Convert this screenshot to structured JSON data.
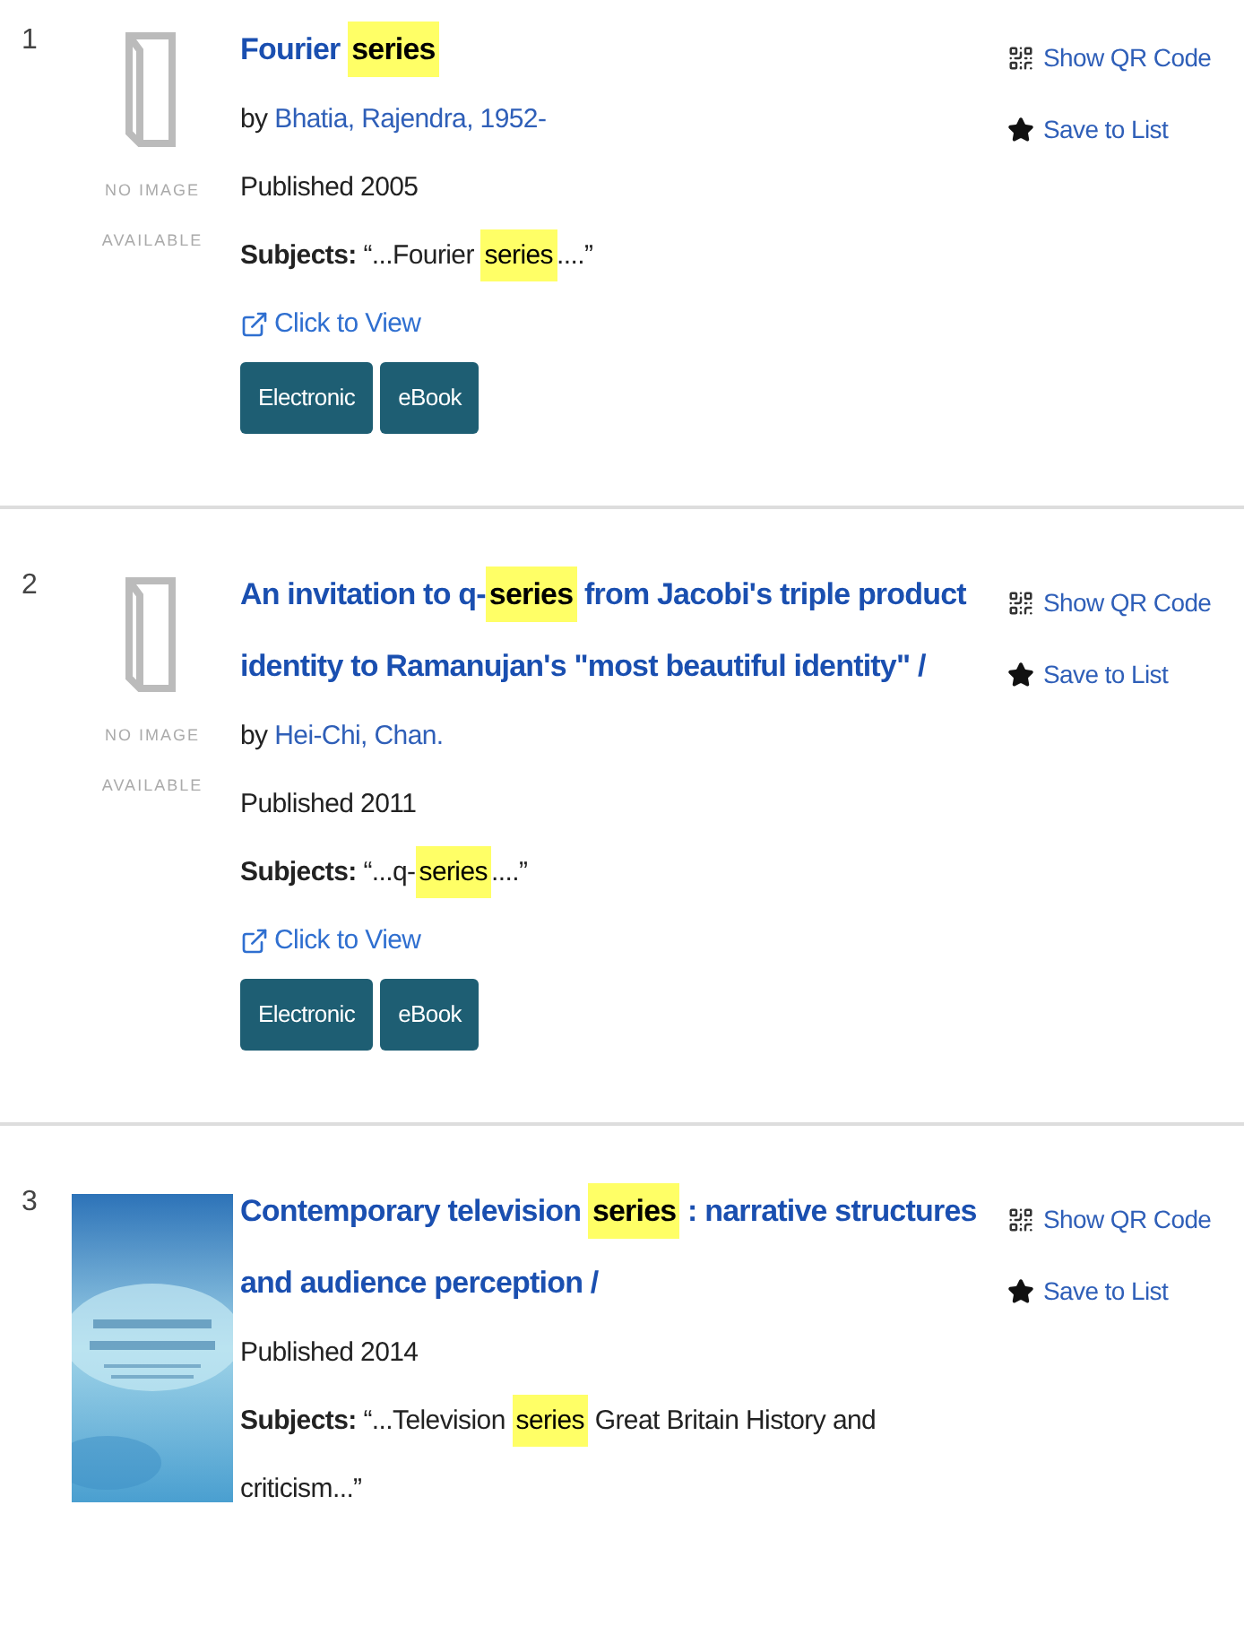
{
  "results": [
    {
      "number": "1",
      "cover": {
        "kind": "placeholder",
        "lines": [
          "NO IMAGE",
          "AVAILABLE"
        ]
      },
      "title": [
        {
          "text": "Fourier ",
          "highlight": false
        },
        {
          "text": "series",
          "highlight": true
        }
      ],
      "author_prefix": "by",
      "author": "Bhatia, Rajendra, 1952-",
      "published": "Published 2005",
      "subjects_label": "Subjects:",
      "subjects": [
        {
          "text": "“...Fourier ",
          "highlight": false
        },
        {
          "text": "series",
          "highlight": true
        },
        {
          "text": "....”",
          "highlight": false
        }
      ],
      "link": "Click to View",
      "formats": [
        "Electronic",
        "eBook"
      ],
      "actions": [
        {
          "kind": "qr",
          "label": "Show QR Code"
        },
        {
          "kind": "save",
          "label": "Save to List"
        }
      ]
    },
    {
      "number": "2",
      "cover": {
        "kind": "placeholder",
        "lines": [
          "NO IMAGE",
          "AVAILABLE"
        ]
      },
      "title": [
        {
          "text": "An invitation to q-",
          "highlight": false
        },
        {
          "text": "series",
          "highlight": true
        },
        {
          "text": " from Jacobi's triple product identity to Ramanujan's \"most beautiful identity\" /",
          "highlight": false
        }
      ],
      "author_prefix": "by",
      "author": "Hei-Chi, Chan.",
      "published": "Published 2011",
      "subjects_label": "Subjects:",
      "subjects": [
        {
          "text": "“...q-",
          "highlight": false
        },
        {
          "text": "series",
          "highlight": true
        },
        {
          "text": "....”",
          "highlight": false
        }
      ],
      "link": "Click to View",
      "formats": [
        "Electronic",
        "eBook"
      ],
      "actions": [
        {
          "kind": "qr",
          "label": "Show QR Code"
        },
        {
          "kind": "save",
          "label": "Save to List"
        }
      ]
    },
    {
      "number": "3",
      "cover": {
        "kind": "picture"
      },
      "title": [
        {
          "text": "Contemporary television ",
          "highlight": false
        },
        {
          "text": "series",
          "highlight": true
        },
        {
          "text": " : narrative structures and audience perception /",
          "highlight": false
        }
      ],
      "published": "Published 2014",
      "subjects_label": "Subjects:",
      "subjects": [
        {
          "text": "“...Television ",
          "highlight": false
        },
        {
          "text": "series",
          "highlight": true
        },
        {
          "text": " Great Britain History and criticism...”",
          "highlight": false
        }
      ],
      "actions": [
        {
          "kind": "qr",
          "label": "Show QR Code"
        },
        {
          "kind": "save",
          "label": "Save to List"
        }
      ]
    }
  ]
}
